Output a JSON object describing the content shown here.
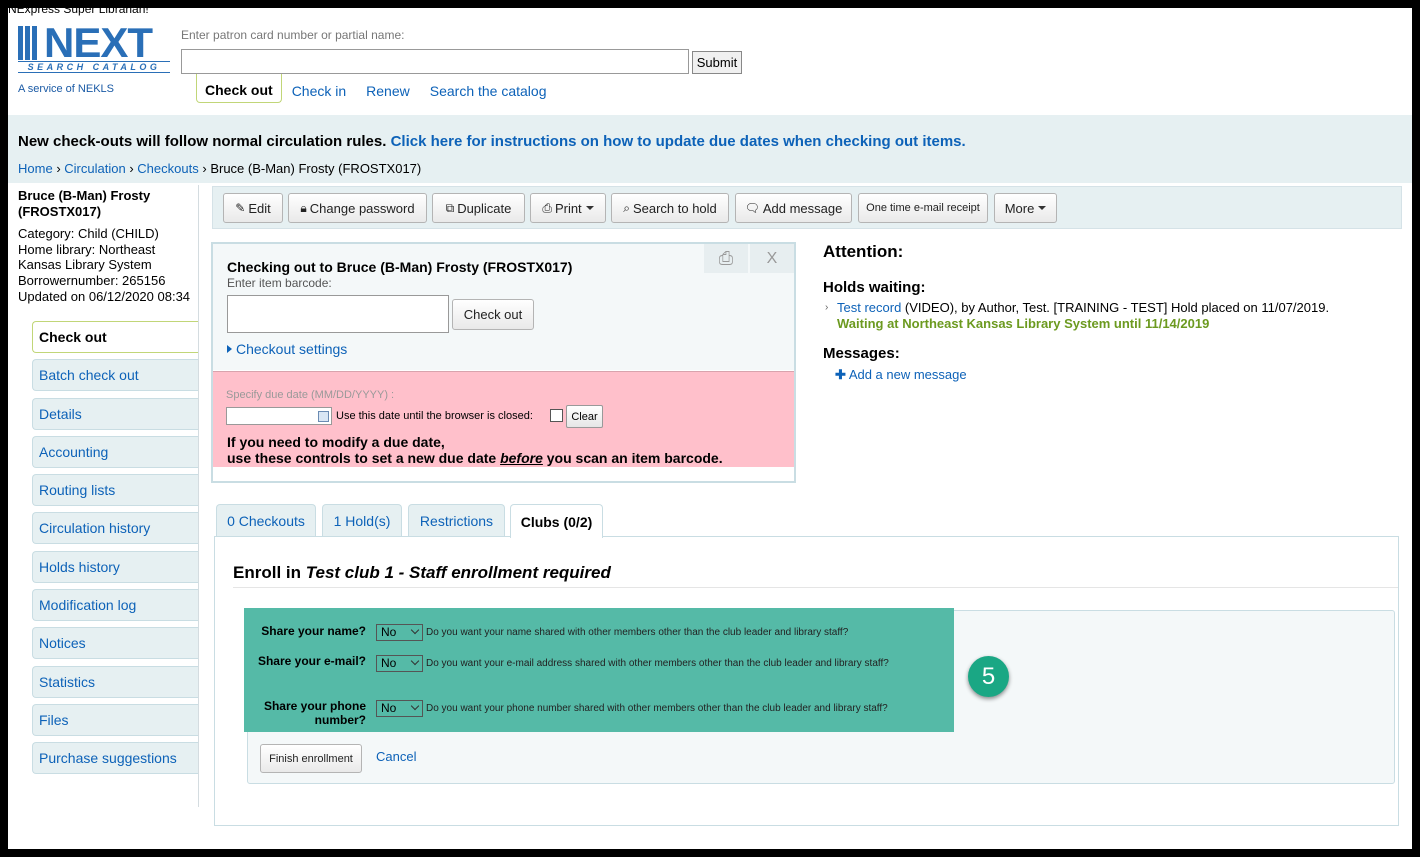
{
  "app": {
    "user_label": "NExpress Super Librarian!"
  },
  "logo": {
    "word": "NEXT",
    "subtitle": "SEARCH CATALOG",
    "service": "A service of NEKLS",
    "brand_color": "#2a6fb7"
  },
  "header": {
    "patron_search_label": "Enter patron card number or partial name:",
    "patron_search_value": "",
    "submit_label": "Submit",
    "tabs": [
      {
        "label": "Check out",
        "active": true
      },
      {
        "label": "Check in",
        "active": false
      },
      {
        "label": "Renew",
        "active": false
      },
      {
        "label": "Search the catalog",
        "active": false
      }
    ]
  },
  "banner": {
    "message": "New check-outs will follow normal circulation rules.",
    "link": "Click here for instructions on how to update due dates when checking out items."
  },
  "breadcrumb": {
    "items": [
      "Home",
      "Circulation",
      "Checkouts"
    ],
    "current": "Bruce (B-Man) Frosty (FROSTX017)",
    "separator": "›"
  },
  "patron": {
    "name": "Bruce (B-Man) Frosty",
    "cardnumber": "(FROSTX017)",
    "category": "Category: Child (CHILD)",
    "home_library_line1": "Home library: Northeast",
    "home_library_line2": "Kansas Library System",
    "borrowernumber": "Borrowernumber: 265156",
    "updated": "Updated on 06/12/2020 08:34"
  },
  "sidebar": {
    "items": [
      {
        "label": "Check out",
        "active": true
      },
      {
        "label": "Batch check out"
      },
      {
        "label": "Details"
      },
      {
        "label": "Accounting"
      },
      {
        "label": "Routing lists"
      },
      {
        "label": "Circulation history"
      },
      {
        "label": "Holds history"
      },
      {
        "label": "Modification log"
      },
      {
        "label": "Notices"
      },
      {
        "label": "Statistics"
      },
      {
        "label": "Files"
      },
      {
        "label": "Purchase suggestions"
      }
    ]
  },
  "toolbar": {
    "edit": "Edit",
    "change_password": "Change password",
    "duplicate": "Duplicate",
    "print": "Print",
    "search_to_hold": "Search to hold",
    "add_message": "Add message",
    "one_time_email": "One time e-mail receipt",
    "more": "More",
    "icons": {
      "edit": "pencil-icon",
      "change_password": "lock-icon",
      "duplicate": "copy-icon",
      "print": "printer-icon",
      "search_to_hold": "search-icon",
      "add_message": "comment-icon"
    }
  },
  "checkout": {
    "title": "Checking out to Bruce (B-Man) Frosty (FROSTX017)",
    "barcode_label": "Enter item barcode:",
    "barcode_value": "",
    "button": "Check out",
    "settings_link": "Checkout settings",
    "print_icon": "printer-icon",
    "close_glyph": "X"
  },
  "due_date": {
    "label": "Specify due date (MM/DD/YYYY) :",
    "value": "",
    "remember_label": "Use this date until the browser is closed:",
    "clear": "Clear",
    "warning_line1": "If you need to modify a due date,",
    "warning_pre": "use these controls to set a new due date ",
    "warning_em": "before",
    "warning_post": " you scan an item barcode."
  },
  "attention": {
    "title": "Attention:",
    "holds_heading": "Holds waiting:",
    "hold_title": "Test record",
    "hold_details": " (VIDEO), by Author, Test. [TRAINING - TEST] Hold placed on 11/07/2019.",
    "hold_waiting": "Waiting at Northeast Kansas Library System until 11/14/2019",
    "messages_heading": "Messages:",
    "add_message": "Add a new message"
  },
  "tabs": [
    {
      "label": "0 Checkouts",
      "active": false
    },
    {
      "label": "1 Hold(s)",
      "active": false
    },
    {
      "label": "Restrictions",
      "active": false
    },
    {
      "label": "Clubs (0/2)",
      "active": true
    }
  ],
  "enrollment": {
    "prefix": "Enroll in ",
    "club": "Test club 1 - Staff enrollment required",
    "fields": [
      {
        "label": "Share your name?",
        "value": "No",
        "hint": "Do you want your name shared with other members other than the club leader and library staff?"
      },
      {
        "label": "Share your e-mail?",
        "value": "No",
        "hint": "Do you want your e-mail address shared with other members other than the club leader and library staff?"
      },
      {
        "label": "Share your phone number?",
        "value": "No",
        "hint": "Do you want your phone number shared with other members other than the club leader and library staff?"
      }
    ],
    "finish": "Finish enrollment",
    "cancel": "Cancel",
    "highlight_color": "#55baa7"
  },
  "annotation": {
    "step": "5"
  }
}
